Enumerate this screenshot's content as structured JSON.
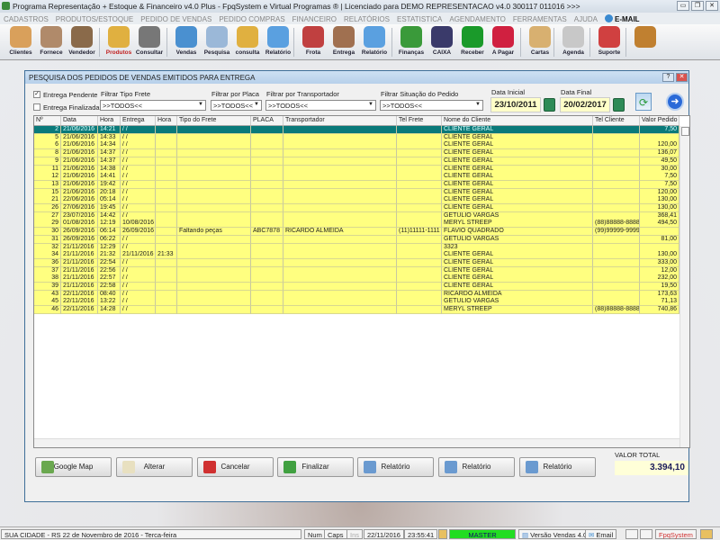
{
  "window": {
    "title": "Programa Representação + Estoque & Financeiro v4.0 Plus - FpqSystem e Virtual Programas ® | Licenciado para  DEMO REPRESENTACAO v4.0 300117 011016 >>>",
    "minimize": "▭",
    "maximize": "❐",
    "close": "✕"
  },
  "menu": [
    "CADASTROS",
    "PRODUTOS/ESTOQUE",
    "PEDIDO DE VENDAS",
    "PEDIDO COMPRAS",
    "FINANCEIRO",
    "RELATÓRIOS",
    "ESTATISTICA",
    "AGENDAMENTO",
    "FERRAMENTAS",
    "AJUDA"
  ],
  "menu_email": "E-MAIL",
  "toolbar": [
    {
      "label": "Clientes",
      "icon": "clients-icon",
      "color": "#d9a05b"
    },
    {
      "label": "Fornece",
      "icon": "supplier-icon",
      "color": "#b08a6a"
    },
    {
      "label": "Vendedor",
      "icon": "seller-icon",
      "color": "#8a6a4a"
    },
    {
      "label": "Produtos",
      "icon": "products-icon",
      "color": "#e0b040"
    },
    {
      "label": "Consultar",
      "icon": "barcode-icon",
      "color": "#777"
    },
    {
      "label": "Vendas",
      "icon": "monitor-icon",
      "color": "#4a90d0"
    },
    {
      "label": "Pesquisa",
      "icon": "search-icon",
      "color": "#9bb8d8"
    },
    {
      "label": "consulta",
      "icon": "folder-icon",
      "color": "#e0b040"
    },
    {
      "label": "Relatório",
      "icon": "report-icon",
      "color": "#5aa0e0"
    },
    {
      "label": "Frota",
      "icon": "truck-icon",
      "color": "#c04040"
    },
    {
      "label": "Entrega",
      "icon": "handtruck-icon",
      "color": "#a07050"
    },
    {
      "label": "Relatório",
      "icon": "report-icon",
      "color": "#5aa0e0"
    },
    {
      "label": "Finanças",
      "icon": "finance-icon",
      "color": "#3a9a3a"
    },
    {
      "label": "CAIXA",
      "icon": "cashbook-icon",
      "color": "#3a3a6a"
    },
    {
      "label": "Receber",
      "icon": "dollar-green-icon",
      "color": "#1a9a2a"
    },
    {
      "label": "A Pagar",
      "icon": "dollar-red-icon",
      "color": "#d02040"
    },
    {
      "label": "Cartas",
      "icon": "scroll-icon",
      "color": "#d8b070"
    },
    {
      "label": "Agenda",
      "icon": "calendar-icon",
      "color": "#c8c8c8"
    },
    {
      "label": "Suporte",
      "icon": "support-icon",
      "color": "#d04040"
    },
    {
      "label": "",
      "icon": "exit-icon",
      "color": "#c08030"
    }
  ],
  "dialog": {
    "title": "PESQUISA DOS PEDIDOS DE VENDAS EMITIDOS PARA ENTREGA",
    "help": "?",
    "close": "✕"
  },
  "filters": {
    "pendente": {
      "label": "Entrega Pendente",
      "checked": true
    },
    "finalizada": {
      "label": "Entrega Finalizada",
      "checked": false
    },
    "tipo_frete": {
      "label": "Filtrar Tipo Frete",
      "value": ">>TODOS<<"
    },
    "placa": {
      "label": "Filtrar por Placa",
      "value": ">>TODOS<<"
    },
    "transportador": {
      "label": "Filtrar por Transportador",
      "value": ">>TODOS<<"
    },
    "situacao": {
      "label": "Filtrar Situação do Pedido",
      "value": ">>TODOS<<"
    },
    "data_inicial": {
      "label": "Data Inicial",
      "value": "23/10/2011"
    },
    "data_final": {
      "label": "Data Final",
      "value": "20/02/2017"
    }
  },
  "columns": [
    "Nº",
    "Data",
    "Hora",
    "Entrega",
    "Hora",
    "Tipo do Frete",
    "PLACA",
    "Transportador",
    "Tel Frete",
    "Nome do Cliente",
    "Tel Cliente",
    "Valor Pedido"
  ],
  "rows": [
    [
      "2",
      "21/06/2016",
      "14:21",
      " / /",
      "",
      "",
      "",
      "",
      "",
      "CLIENTE GERAL",
      "",
      "7,50"
    ],
    [
      "5",
      "21/06/2016",
      "14:33",
      " / /",
      "",
      "",
      "",
      "",
      "",
      "CLIENTE GERAL",
      "",
      ""
    ],
    [
      "6",
      "21/06/2016",
      "14:34",
      " / /",
      "",
      "",
      "",
      "",
      "",
      "CLIENTE GERAL",
      "",
      "120,00"
    ],
    [
      "8",
      "21/06/2016",
      "14:37",
      " / /",
      "",
      "",
      "",
      "",
      "",
      "CLIENTE GERAL",
      "",
      "136,07"
    ],
    [
      "9",
      "21/06/2016",
      "14:37",
      " / /",
      "",
      "",
      "",
      "",
      "",
      "CLIENTE GERAL",
      "",
      "49,50"
    ],
    [
      "11",
      "21/06/2016",
      "14:38",
      " / /",
      "",
      "",
      "",
      "",
      "",
      "CLIENTE GERAL",
      "",
      "30,00"
    ],
    [
      "12",
      "21/06/2016",
      "14:41",
      " / /",
      "",
      "",
      "",
      "",
      "",
      "CLIENTE GERAL",
      "",
      "7,50"
    ],
    [
      "13",
      "21/06/2016",
      "19:42",
      " / /",
      "",
      "",
      "",
      "",
      "",
      "CLIENTE GERAL",
      "",
      "7,50"
    ],
    [
      "15",
      "21/06/2016",
      "20:18",
      " / /",
      "",
      "",
      "",
      "",
      "",
      "CLIENTE GERAL",
      "",
      "120,00"
    ],
    [
      "21",
      "22/06/2016",
      "05:14",
      " / /",
      "",
      "",
      "",
      "",
      "",
      "CLIENTE GERAL",
      "",
      "130,00"
    ],
    [
      "26",
      "27/06/2016",
      "19:45",
      " / /",
      "",
      "",
      "",
      "",
      "",
      "CLIENTE GERAL",
      "",
      "130,00"
    ],
    [
      "27",
      "23/07/2016",
      "14:42",
      " / /",
      "",
      "",
      "",
      "",
      "",
      "GETULIO VARGAS",
      "",
      "368,41"
    ],
    [
      "29",
      "01/08/2016",
      "12:19",
      "10/08/2016",
      "",
      "",
      "",
      "",
      "",
      "MERYL STREEP",
      "(88)88888-8888",
      "494,50"
    ],
    [
      "30",
      "26/09/2016",
      "06:14",
      "26/09/2016",
      "",
      "Faltando peças",
      "ABC7878",
      "RICARDO ALMEIDA",
      "(11)11111-1111",
      "FLAVIO QUADRADO",
      "(99)99999-9999",
      ""
    ],
    [
      "31",
      "26/09/2016",
      "06:22",
      " / /",
      "",
      "",
      "",
      "",
      "",
      "GETULIO VARGAS",
      "",
      "81,00"
    ],
    [
      "32",
      "21/11/2016",
      "12:29",
      " / /",
      "",
      "",
      "",
      "",
      "",
      "3323",
      "",
      ""
    ],
    [
      "34",
      "21/11/2016",
      "21:32",
      "21/11/2016",
      "21:33",
      "",
      "",
      "",
      "",
      "CLIENTE GERAL",
      "",
      "130,00"
    ],
    [
      "36",
      "21/11/2016",
      "22:54",
      " / /",
      "",
      "",
      "",
      "",
      "",
      "CLIENTE GERAL",
      "",
      "333,00"
    ],
    [
      "37",
      "21/11/2016",
      "22:56",
      " / /",
      "",
      "",
      "",
      "",
      "",
      "CLIENTE GERAL",
      "",
      "12,00"
    ],
    [
      "38",
      "21/11/2016",
      "22:57",
      " / /",
      "",
      "",
      "",
      "",
      "",
      "CLIENTE GERAL",
      "",
      "232,00"
    ],
    [
      "39",
      "21/11/2016",
      "22:58",
      " / /",
      "",
      "",
      "",
      "",
      "",
      "CLIENTE GERAL",
      "",
      "19,50"
    ],
    [
      "43",
      "22/11/2016",
      "08:40",
      " / /",
      "",
      "",
      "",
      "",
      "",
      "RICARDO ALMEIDA",
      "",
      "173,63"
    ],
    [
      "45",
      "22/11/2016",
      "13:22",
      " / /",
      "",
      "",
      "",
      "",
      "",
      "GETULIO VARGAS",
      "",
      "71,13"
    ],
    [
      "46",
      "22/11/2016",
      "14:28",
      " / /",
      "",
      "",
      "",
      "",
      "",
      "MERYL STREEP",
      "(88)88888-8888",
      "740,86"
    ]
  ],
  "selected_row": 0,
  "buttons": [
    {
      "label": "Google Map",
      "icon": "map-icon",
      "color": "#6aa84f"
    },
    {
      "label": "Alterar",
      "icon": "pencil-icon",
      "color": "#e8e0c0"
    },
    {
      "label": "Cancelar",
      "icon": "cancel-doc-icon",
      "color": "#d03030"
    },
    {
      "label": "Finalizar",
      "icon": "finalize-doc-icon",
      "color": "#40a040"
    },
    {
      "label": "Relatório",
      "icon": "printer-icon",
      "color": "#6a9ad0"
    },
    {
      "label": "Relatório",
      "icon": "printer-icon",
      "color": "#6a9ad0"
    },
    {
      "label": "Relatório",
      "icon": "printer-icon",
      "color": "#6a9ad0"
    }
  ],
  "total": {
    "label": "VALOR TOTAL",
    "value": "3.394,10"
  },
  "status": {
    "city": "SUA CIDADE - RS 22 de Novembro de 2016 - Terca-feira",
    "num": "Num",
    "caps": "Caps",
    "ins": "Ins",
    "date": "22/11/2016",
    "time": "23:55:41",
    "user": "MASTER",
    "version": "Versão Vendas 4.0",
    "email": "Email",
    "brand": "FpqSystem"
  }
}
